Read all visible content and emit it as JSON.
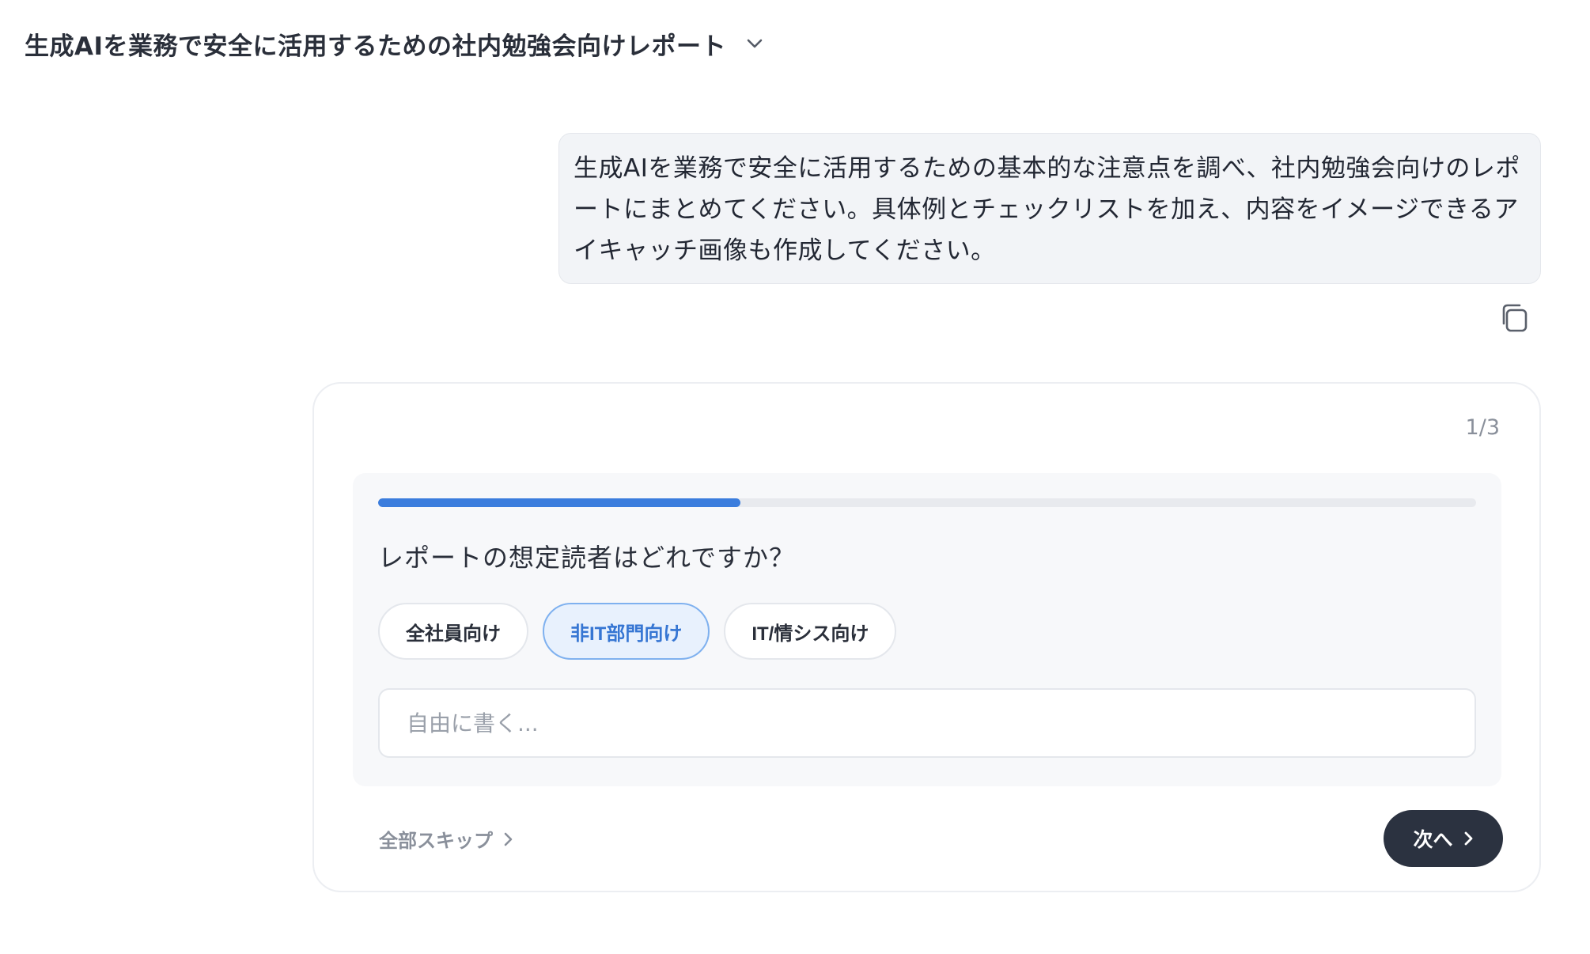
{
  "header": {
    "title": "生成AIを業務で安全に活用するための社内勉強会向けレポート"
  },
  "user_message": {
    "text": "生成AIを業務で安全に活用するための基本的な注意点を調べ、社内勉強会向けのレポートにまとめてください。具体例とチェックリストを加え、内容をイメージできるアイキャッチ画像も作成してください。"
  },
  "card": {
    "step_counter": "1/3",
    "progress": 0.33,
    "question": "レポートの想定読者はどれですか？",
    "options": [
      {
        "label": "全社員向け",
        "selected": false
      },
      {
        "label": "非IT部門向け",
        "selected": true
      },
      {
        "label": "IT/情シス向け",
        "selected": false
      }
    ],
    "free_input": {
      "placeholder": "自由に書く...",
      "value": ""
    },
    "skip_all_label": "全部スキップ",
    "next_label": "次へ"
  },
  "colors": {
    "accent": "#3b7ddd",
    "selected_bg": "#e8f1fd",
    "next_button_bg": "#2b3240"
  }
}
